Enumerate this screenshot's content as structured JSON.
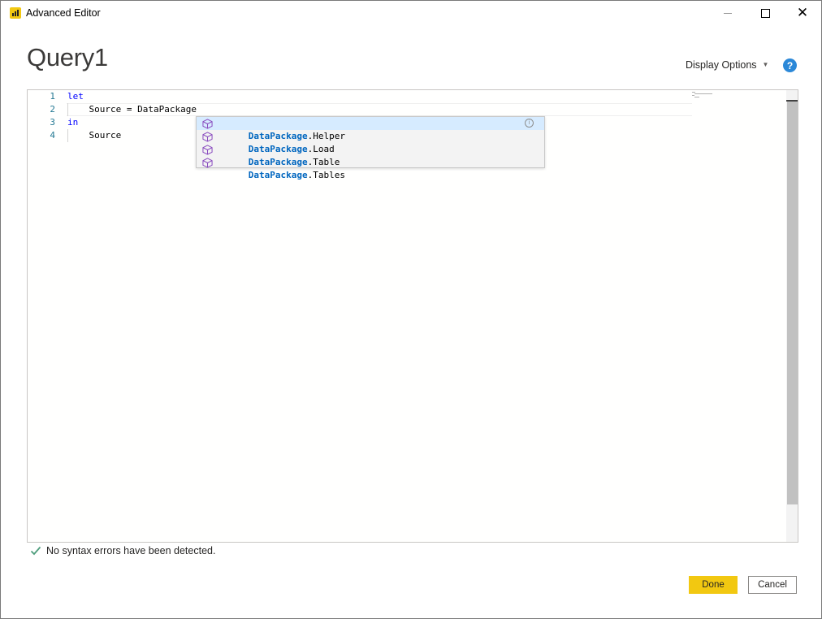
{
  "window": {
    "title": "Advanced Editor"
  },
  "header": {
    "query_name": "Query1",
    "display_options_label": "Display Options",
    "help_label": "?"
  },
  "editor": {
    "lines": [
      {
        "number": "1",
        "text": "let"
      },
      {
        "number": "2",
        "text": "    Source = DataPackage"
      },
      {
        "number": "3",
        "text": "in"
      },
      {
        "number": "4",
        "text": "    Source"
      }
    ],
    "autocomplete": {
      "typed_prefix": "DataPackage",
      "items": [
        {
          "match": "DataPackage",
          "rest": ".Helper",
          "icon": "cube-icon"
        },
        {
          "match": "DataPackage",
          "rest": ".Load",
          "icon": "cube-icon"
        },
        {
          "match": "DataPackage",
          "rest": ".Table",
          "icon": "cube-icon"
        },
        {
          "match": "DataPackage",
          "rest": ".Tables",
          "icon": "cube-icon"
        }
      ]
    }
  },
  "status": {
    "message": "No syntax errors have been detected.",
    "icon": "checkmark-icon"
  },
  "buttons": {
    "done": "Done",
    "cancel": "Cancel"
  },
  "colors": {
    "accent": "#f2c811",
    "keyword": "#0000ff",
    "line_number": "#237893",
    "suggest_match": "#0066bf",
    "suggest_selected_bg": "#d6ebff",
    "help": "#2b88d8",
    "success": "#4f9e7d"
  }
}
